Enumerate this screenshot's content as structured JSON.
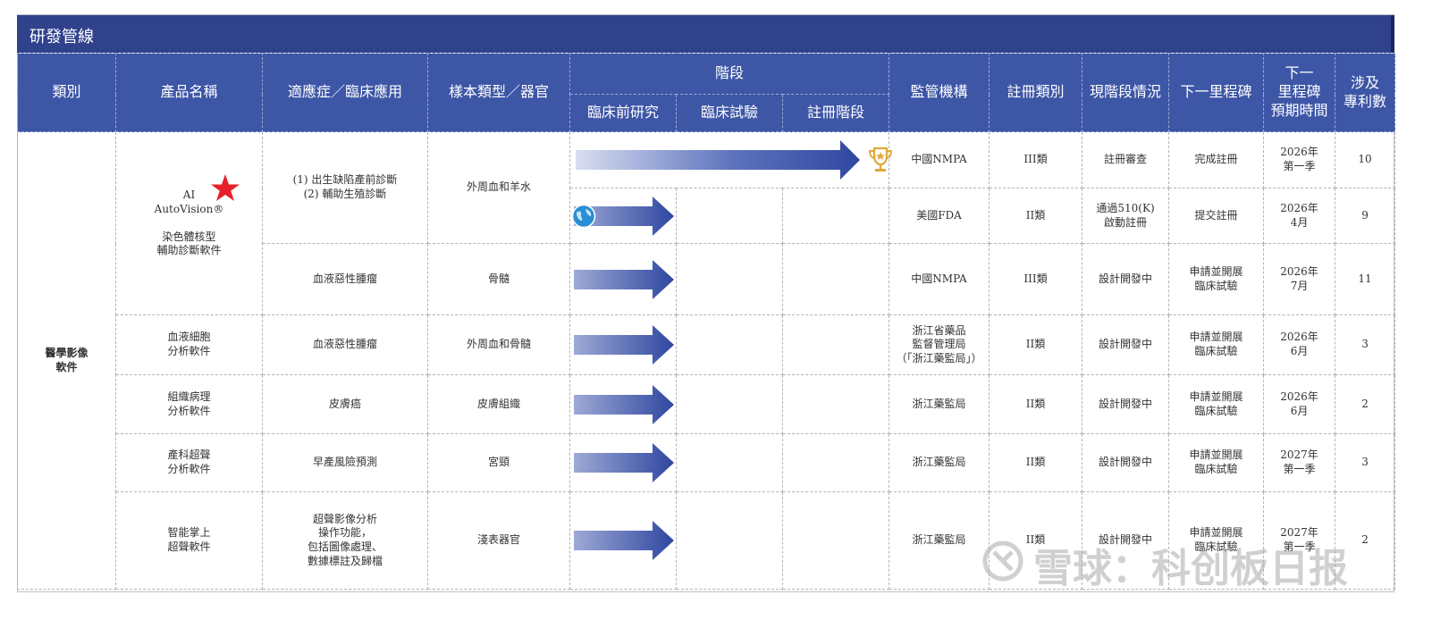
{
  "title": "研發管線",
  "headers": {
    "category": "類別",
    "product": "產品名稱",
    "indication": "適應症／臨床應用",
    "sample": "樣本類型／器官",
    "stage": "階段",
    "stage_preclinical": "臨床前研究",
    "stage_clinical": "臨床試驗",
    "stage_registration": "註冊階段",
    "regulator": "監管機構",
    "reg_class": "註冊類別",
    "status": "現階段情況",
    "next_milestone": "下一里程碑",
    "expected_time": "下一\n里程碑\n預期時間",
    "patents": "涉及\n專利數"
  },
  "category": "醫學影像\n軟件",
  "rows": [
    {
      "product": "AI\nAutoVision®\n\n染色體核型\n輔助診斷軟件",
      "indication": "(1) 出生缺陷產前診斷\n(2) 輔助生殖診斷",
      "sample": "外周血和羊水",
      "regulator": "中國NMPA",
      "reg_class": "III類",
      "status": "註冊審查",
      "milestone": "完成註冊",
      "time": "2026年\n第一季",
      "patents": "10",
      "progress": 3
    },
    {
      "regulator": "美國FDA",
      "reg_class": "II類",
      "status": "通過510(K)\n啟動註冊",
      "milestone": "提交註冊",
      "time": "2026年\n4月",
      "patents": "9",
      "progress": 1
    },
    {
      "indication": "血液惡性腫瘤",
      "sample": "骨髓",
      "regulator": "中國NMPA",
      "reg_class": "III類",
      "status": "設計開發中",
      "milestone": "申請並開展\n臨床試驗",
      "time": "2026年\n7月",
      "patents": "11",
      "progress": 1
    },
    {
      "product": "血液細胞\n分析軟件",
      "indication": "血液惡性腫瘤",
      "sample": "外周血和骨髓",
      "regulator": "浙江省藥品\n監督管理局\n（「浙江藥監局」）",
      "reg_class": "II類",
      "status": "設計開發中",
      "milestone": "申請並開展\n臨床試驗",
      "time": "2026年\n6月",
      "patents": "3",
      "progress": 1
    },
    {
      "product": "組織病理\n分析軟件",
      "indication": "皮膚癌",
      "sample": "皮膚組織",
      "regulator": "浙江藥監局",
      "reg_class": "II類",
      "status": "設計開發中",
      "milestone": "申請並開展\n臨床試驗",
      "time": "2026年\n6月",
      "patents": "2",
      "progress": 1
    },
    {
      "product": "產科超聲\n分析軟件",
      "indication": "早產風險預測",
      "sample": "宮頸",
      "regulator": "浙江藥監局",
      "reg_class": "II類",
      "status": "設計開發中",
      "milestone": "申請並開展\n臨床試驗",
      "time": "2027年\n第一季",
      "patents": "3",
      "progress": 1
    },
    {
      "product": "智能掌上\n超聲軟件",
      "indication": "超聲影像分析\n操作功能，\n包括圖像處理、\n數據標註及歸檔",
      "sample": "淺表器官",
      "regulator": "浙江藥監局",
      "reg_class": "II類",
      "status": "設計開發中",
      "milestone": "申請並開展\n臨床試驗",
      "time": "2027年\n第一季",
      "patents": "2",
      "progress": 1
    }
  ],
  "watermark": "雪球：科创板日报",
  "colors": {
    "header_bg": "#3d56a6",
    "title_bg": "#31428c",
    "arrow": "#2f47a0",
    "star": "#e8202a",
    "category_text": "#2d3e8a"
  }
}
